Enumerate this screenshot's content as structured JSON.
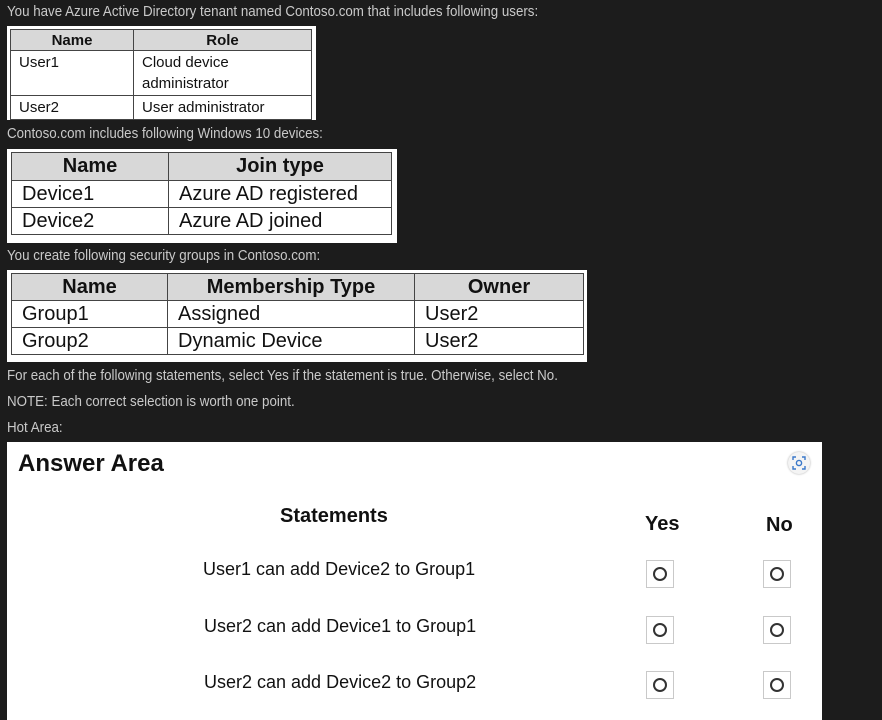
{
  "intro": {
    "users_text": "You have Azure Active Directory tenant named Contoso.com that includes following users:",
    "devices_text": "Contoso.com includes following Windows 10 devices:",
    "groups_text": "You create following security groups in Contoso.com:",
    "instruction_text": "For each of the following statements, select Yes if the statement is true. Otherwise, select No.",
    "note_text": "NOTE: Each correct selection is worth one point.",
    "hot_area_text": "Hot Area:"
  },
  "users_table": {
    "headers": [
      "Name",
      "Role"
    ],
    "rows": [
      [
        "User1",
        "Cloud device administrator"
      ],
      [
        "User2",
        "User administrator"
      ]
    ]
  },
  "devices_table": {
    "headers": [
      "Name",
      "Join type"
    ],
    "rows": [
      [
        "Device1",
        "Azure AD registered"
      ],
      [
        "Device2",
        "Azure AD joined"
      ]
    ]
  },
  "groups_table": {
    "headers": [
      "Name",
      "Membership Type",
      "Owner"
    ],
    "rows": [
      [
        "Group1",
        "Assigned",
        "User2"
      ],
      [
        "Group2",
        "Dynamic Device",
        "User2"
      ]
    ]
  },
  "answer_area": {
    "title": "Answer Area",
    "statements_header": "Statements",
    "yes_header": "Yes",
    "no_header": "No",
    "statements": [
      "User1 can add Device2 to Group1",
      "User2 can add Device1 to Group1",
      "User2 can add Device2 to Group2"
    ],
    "zoom_icon": "scan-zoom-icon"
  }
}
